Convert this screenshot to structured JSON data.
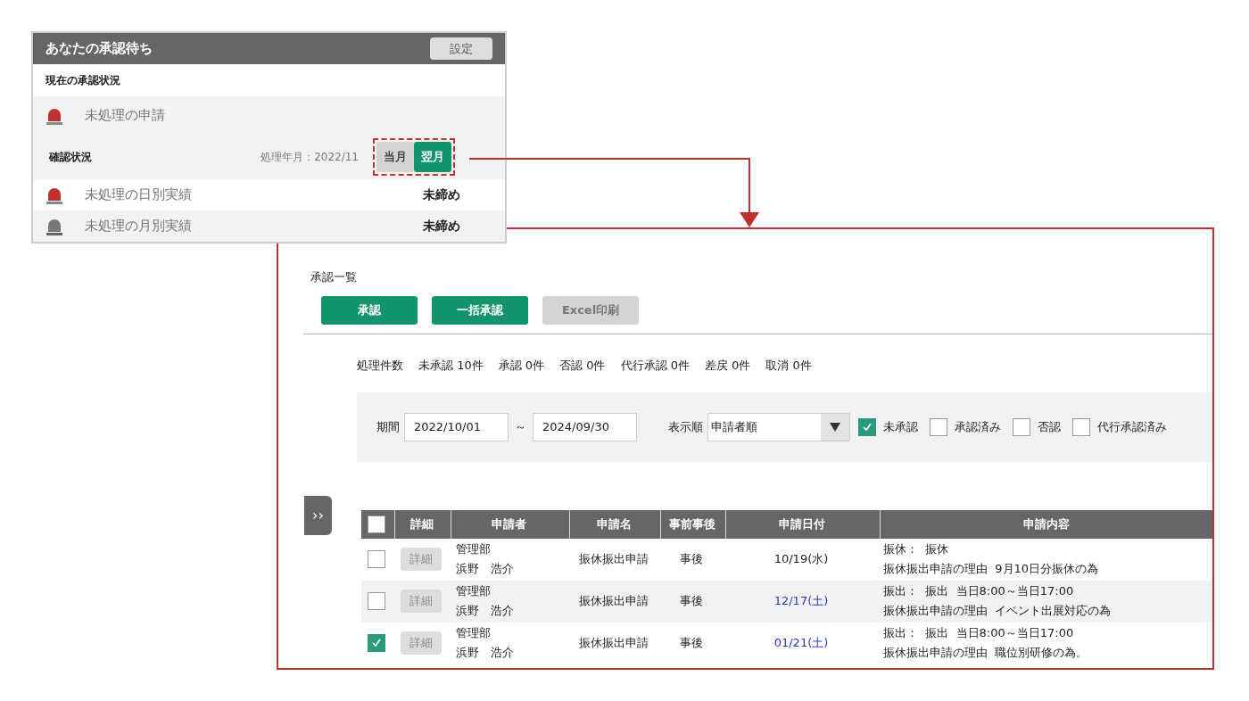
{
  "widget": {
    "title": "あなたの承認待ち",
    "settings_button": "設定",
    "section_label": "現在の承認状況",
    "pending": {
      "label": "未処理の申請",
      "alert": true
    },
    "confirm": {
      "label": "確認状況",
      "period": "処理年月：2022/11",
      "months": [
        {
          "label": "当月",
          "selected": false
        },
        {
          "label": "翌月",
          "selected": true
        }
      ],
      "highlighted": true
    },
    "items": [
      {
        "label": "未処理の日別実績",
        "alert": true,
        "status": "未締め"
      },
      {
        "label": "未処理の月別実績",
        "alert": false,
        "status": "未締め"
      }
    ]
  },
  "approval_list": {
    "title": "承認一覧",
    "buttons": [
      {
        "label": "承認",
        "disabled": false
      },
      {
        "label": "一括承認",
        "disabled": false
      },
      {
        "label": "Excel印刷",
        "disabled": true
      }
    ],
    "counts": [
      "処理件数",
      "未承認 10件",
      "承認 0件",
      "否認 0件",
      "代行承認 0件",
      "差戻 0件",
      "取消 0件"
    ],
    "filter": {
      "period_label": "期間",
      "from": "2022/10/01",
      "separator": "～",
      "to": "2024/09/30",
      "sort_label": "表示順",
      "sort_value": "申請者順",
      "checkboxes": [
        {
          "label": "未承認",
          "checked": true
        },
        {
          "label": "承認済み",
          "checked": false
        },
        {
          "label": "否認",
          "checked": false
        },
        {
          "label": "代行承認済み",
          "checked": false
        }
      ]
    },
    "expand_button": "››",
    "table": {
      "select_all": false,
      "columns": [
        "詳細",
        "申請者",
        "申請名",
        "事前事後",
        "申請日付",
        "申請内容"
      ],
      "rows": [
        {
          "checked": false,
          "detail": "詳細",
          "department": "管理部",
          "name": "浜野　浩介",
          "application": "振休振出申請",
          "timing": "事後",
          "date": "10/19(水)",
          "holiday": false,
          "content": [
            "振休：  振休",
            "振休振出申請の理由  9月10日分振休の為"
          ]
        },
        {
          "checked": false,
          "detail": "詳細",
          "department": "管理部",
          "name": "浜野　浩介",
          "application": "振休振出申請",
          "timing": "事後",
          "date": "12/17(土)",
          "holiday": true,
          "content": [
            "振出：  振出  当日8:00～当日17:00",
            "振休振出申請の理由  イベント出展対応の為"
          ]
        },
        {
          "checked": true,
          "detail": "詳細",
          "department": "管理部",
          "name": "浜野　浩介",
          "application": "振休振出申請",
          "timing": "事後",
          "date": "01/21(土)",
          "holiday": true,
          "content": [
            "振出：  振出  当日8:00～当日17:00",
            "振休振出申請の理由  職位別研修の為。"
          ]
        }
      ]
    }
  }
}
